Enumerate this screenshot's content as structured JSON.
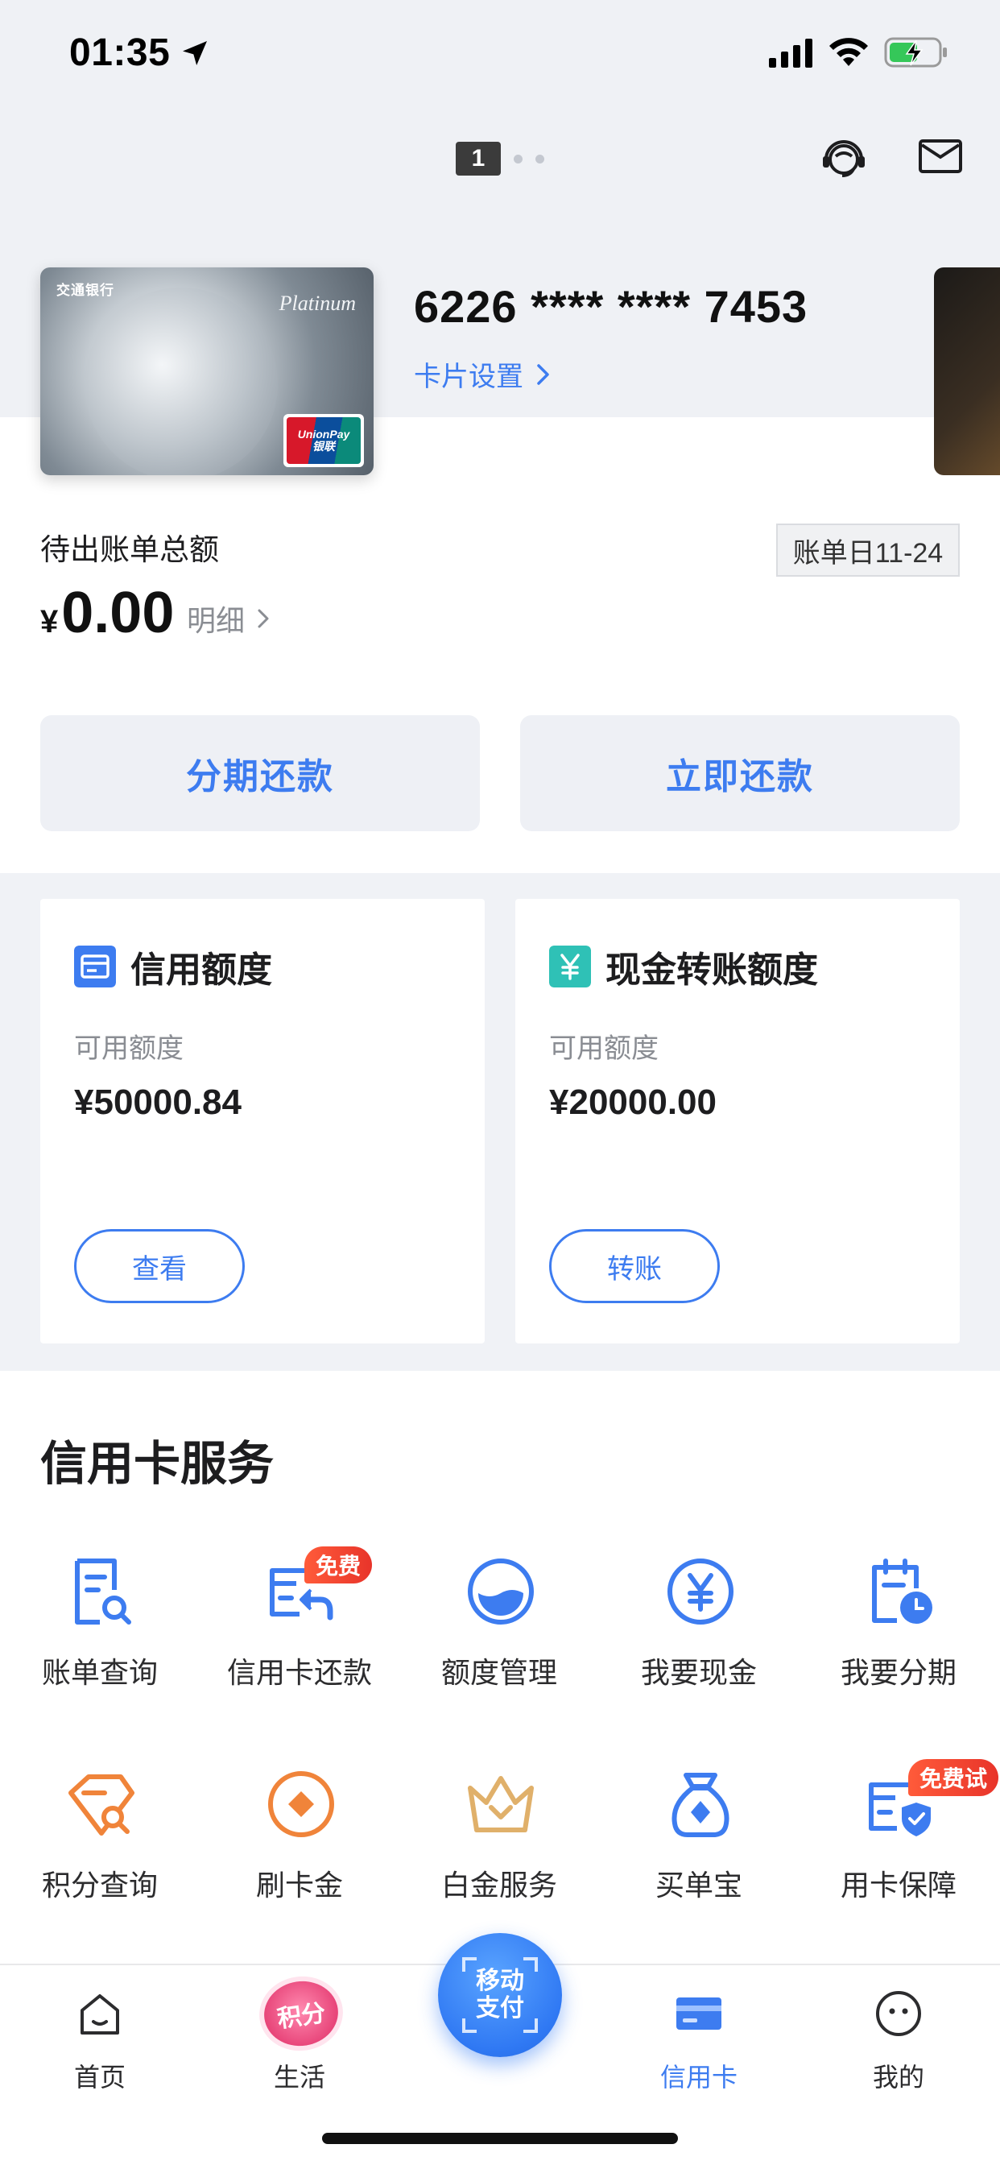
{
  "status_bar": {
    "time": "01:35"
  },
  "header": {
    "page_indicator": "1",
    "icons": [
      "headset-icon",
      "mail-icon"
    ]
  },
  "card": {
    "bank_name_on_card": "交通银行",
    "card_tier": "Platinum",
    "network_line1": "UnionPay",
    "network_line2": "银联",
    "number": "6226 **** **** 7453",
    "settings_label": "卡片设置"
  },
  "bill": {
    "label": "待出账单总额",
    "currency": "¥",
    "amount": "0.00",
    "detail_label": "明细",
    "bill_day": "账单日11-24"
  },
  "actions": {
    "installment_label": "分期还款",
    "repay_label": "立即还款"
  },
  "quota": {
    "credit": {
      "title": "信用额度",
      "sub": "可用额度",
      "value": "¥50000.84",
      "button": "查看"
    },
    "cash": {
      "title": "现金转账额度",
      "sub": "可用额度",
      "value": "¥20000.00",
      "button": "转账"
    }
  },
  "services": {
    "title": "信用卡服务",
    "items": [
      {
        "label": "账单查询",
        "icon": "bill-search-icon"
      },
      {
        "label": "信用卡还款",
        "icon": "card-repay-icon",
        "badge": "免费"
      },
      {
        "label": "额度管理",
        "icon": "limit-gauge-icon"
      },
      {
        "label": "我要现金",
        "icon": "yuan-cash-icon"
      },
      {
        "label": "我要分期",
        "icon": "installment-clock-icon"
      },
      {
        "label": "积分查询",
        "icon": "points-search-icon"
      },
      {
        "label": "刷卡金",
        "icon": "card-bonus-icon"
      },
      {
        "label": "白金服务",
        "icon": "crown-icon"
      },
      {
        "label": "买单宝",
        "icon": "money-bag-icon"
      },
      {
        "label": "用卡保障",
        "icon": "card-shield-icon",
        "badge": "免费试"
      }
    ]
  },
  "tab_bar": {
    "home": "首页",
    "life": "生活",
    "life_badge": "积分",
    "pay_line1": "移动",
    "pay_line2": "支付",
    "credit_card": "信用卡",
    "mine": "我的"
  },
  "colors": {
    "accent": "#3d7cf0",
    "orange": "#f0843a",
    "badge_red": "#e8342a",
    "teal": "#2fc1b6",
    "gold": "#e0b06a"
  }
}
